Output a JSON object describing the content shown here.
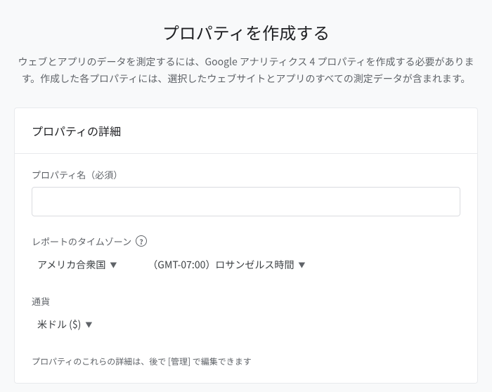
{
  "header": {
    "title": "プロパティを作成する",
    "subtitle": "ウェブとアプリのデータを測定するには、Google アナリティクス 4 プロパティを作成する必要があります。作成した各プロパティには、選択したウェブサイトとアプリのすべての測定データが含まれます。"
  },
  "card": {
    "heading": "プロパティの詳細",
    "property_name_label": "プロパティ名（必須）",
    "property_name_value": "",
    "timezone_label": "レポートのタイムゾーン",
    "help_icon_glyph": "?",
    "country_value": "アメリカ合衆国",
    "timezone_value": "（GMT-07:00）ロサンゼルス時間",
    "currency_label": "通貨",
    "currency_value": "米ドル ($)",
    "footer_hint": "プロパティのこれらの詳細は、後で [管理] で編集できます"
  }
}
